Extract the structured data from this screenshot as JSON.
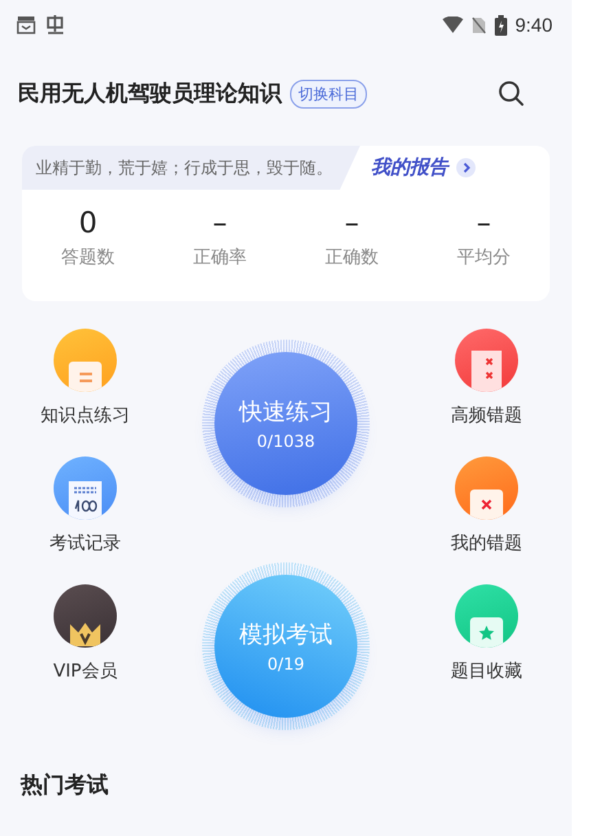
{
  "status_bar": {
    "time": "9:40"
  },
  "header": {
    "title": "民用无人机驾驶员理论知识",
    "switch_label": "切换科目"
  },
  "summary": {
    "motto": "业精于勤，荒于嬉；行成于思，毁于随。",
    "report_link": "我的报告",
    "stats": [
      {
        "value": "0",
        "label": "答题数"
      },
      {
        "value": "–",
        "label": "正确率"
      },
      {
        "value": "–",
        "label": "正确数"
      },
      {
        "value": "–",
        "label": "平均分"
      }
    ]
  },
  "left_shortcuts": [
    {
      "kind": "knowledge",
      "label": "知识点练习"
    },
    {
      "kind": "records",
      "label": "考试记录"
    },
    {
      "kind": "vip",
      "label": "VIP会员"
    }
  ],
  "right_shortcuts": [
    {
      "kind": "frequent",
      "label": "高频错题"
    },
    {
      "kind": "mistakes",
      "label": "我的错题"
    },
    {
      "kind": "favorites",
      "label": "题目收藏"
    }
  ],
  "main_actions": [
    {
      "kind": "practice",
      "label": "快速练习",
      "progress": "0/1038"
    },
    {
      "kind": "exam",
      "label": "模拟考试",
      "progress": "0/19"
    }
  ],
  "section_title": "热门考试"
}
